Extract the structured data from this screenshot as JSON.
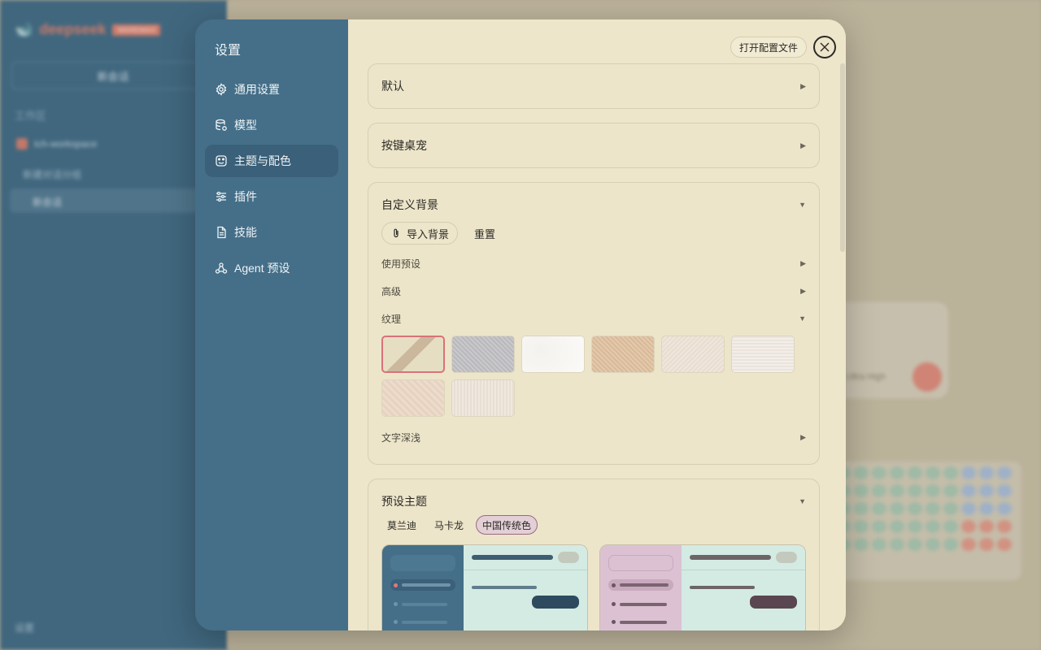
{
  "background": {
    "brand_name": "deepseek",
    "brand_badge": "WAREMAX",
    "new_chat": "新会话",
    "workspace_heading": "工作区",
    "workspace_name": "tch-workspace",
    "folder_name": "新建对话分组",
    "session_name": "新会话",
    "settings_label": "设置",
    "model_effort": "Ultra High"
  },
  "modal": {
    "title": "设置",
    "nav": [
      {
        "label": "通用设置",
        "icon": "gear-icon"
      },
      {
        "label": "模型",
        "icon": "database-icon"
      },
      {
        "label": "主题与配色",
        "icon": "palette-icon",
        "active": true
      },
      {
        "label": "插件",
        "icon": "sliders-icon"
      },
      {
        "label": "技能",
        "icon": "document-icon"
      },
      {
        "label": "Agent 预设",
        "icon": "agent-icon"
      }
    ],
    "open_config": "打开配置文件",
    "panels": {
      "default": {
        "title": "默认",
        "expanded": false
      },
      "pet": {
        "title": "按键桌宠",
        "expanded": false
      },
      "custom_bg": {
        "title": "自定义背景",
        "expanded": true,
        "import_label": "导入背景",
        "reset_label": "重置",
        "use_preset": "使用预设",
        "advanced": "高级",
        "texture": "纹理",
        "text_depth": "文字深浅"
      },
      "preset_theme": {
        "title": "预设主题",
        "expanded": true,
        "tabs": [
          "莫兰迪",
          "马卡龙",
          "中国传统色"
        ],
        "active_tab": "中国传统色"
      }
    }
  },
  "colors": {
    "nav_bg": "#456f88",
    "content_bg": "#ede6cb",
    "accent_selected": "#d8727a",
    "chip_active": "#e3cfd6"
  }
}
